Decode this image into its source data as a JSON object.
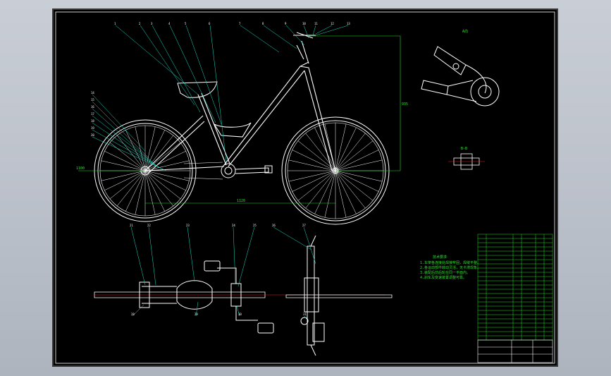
{
  "drawing": {
    "dim_wheelbase": "1120",
    "dim_frame_height": "935",
    "dim_side_left": "1100",
    "tech_req_title": "技术要求",
    "tech_req_lines": [
      "1.车架各连接处焊接牢固，焊缝平整。",
      "2.各运动部件转动灵活，无卡滞现象。",
      "3.装配后前后轮在同一平面内。",
      "4.刹车及变速装置调整可靠。"
    ],
    "part_labels": [
      "1",
      "2",
      "3",
      "4",
      "5",
      "6",
      "7",
      "8",
      "9",
      "10",
      "11",
      "12",
      "13",
      "14",
      "15",
      "16",
      "17",
      "18",
      "19",
      "20",
      "21",
      "22",
      "23",
      "24",
      "25",
      "26",
      "27",
      "28",
      "29",
      "30",
      "31"
    ],
    "detail_a_label": "A向",
    "detail_b_label": "B-B",
    "colors": {
      "lines": "#ffffff",
      "leaders": "#18e0c8",
      "dims": "#1ee01e",
      "tables": "#1ee01e",
      "red": "#e02020"
    }
  }
}
